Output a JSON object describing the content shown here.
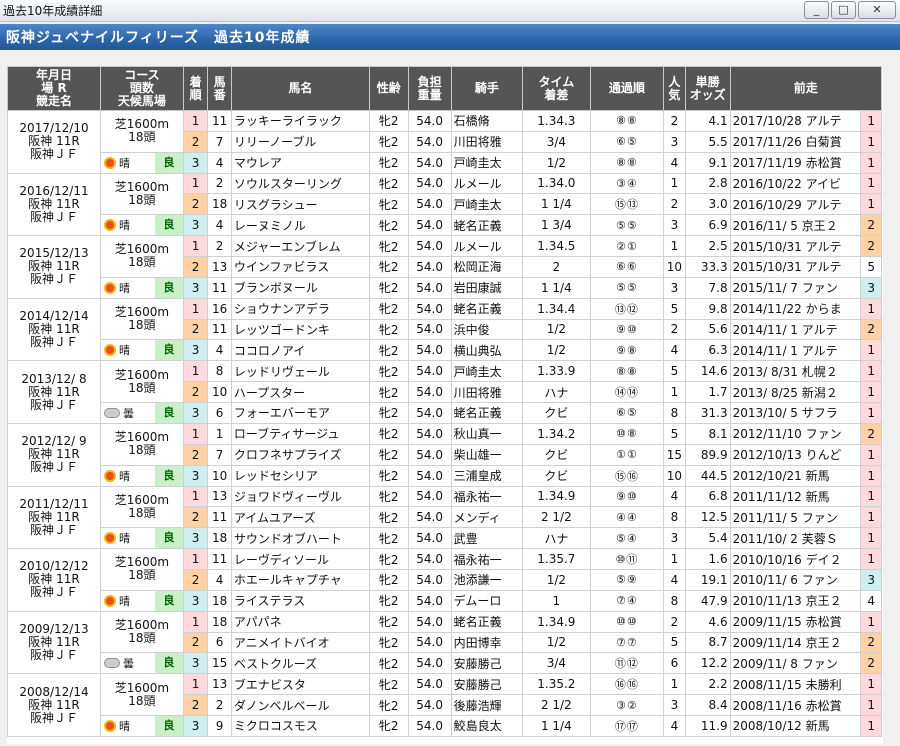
{
  "window": {
    "title": "過去10年成績詳細",
    "btn_min": "_",
    "btn_max": "□",
    "btn_close": "✕"
  },
  "banner": {
    "title": "阪神ジュベナイルフィリーズ　過去10年成績"
  },
  "columns": {
    "date": "年月日\n場 R\n競走名",
    "course": "コース\n頭数\n天候馬場",
    "rank": "着\n順",
    "num": "馬\n番",
    "name": "馬名",
    "sexage": "性齢",
    "weight": "負担\n重量",
    "jockey": "騎手",
    "time": "タイム\n着差",
    "pass": "通過順",
    "pop": "人\n気",
    "odds": "単勝\nオッズ",
    "prev": "前走"
  },
  "races": [
    {
      "date": "2017/12/10\n阪神 11R\n阪神ＪＦ",
      "course": "芝1600m\n18頭",
      "weather": "晴",
      "weather_icon": "sun-icon",
      "ground": "良",
      "rows": [
        {
          "rank": "1",
          "num": "11",
          "name": "ラッキーライラック",
          "sa": "牝2",
          "w": "54.0",
          "j": "石橋脩",
          "t": "1.34.3",
          "p": "⑧⑧",
          "pop": "2",
          "odds": "4.1",
          "prev": "2017/10/28 アルテ",
          "prank": "1"
        },
        {
          "rank": "2",
          "num": "7",
          "name": "リリーノーブル",
          "sa": "牝2",
          "w": "54.0",
          "j": "川田将雅",
          "t": "3/4",
          "p": "⑥⑤",
          "pop": "3",
          "odds": "5.5",
          "prev": "2017/11/26 白菊賞",
          "prank": "1"
        },
        {
          "rank": "3",
          "num": "4",
          "name": "マウレア",
          "sa": "牝2",
          "w": "54.0",
          "j": "戸崎圭太",
          "t": "1/2",
          "p": "⑧⑧",
          "pop": "4",
          "odds": "9.1",
          "prev": "2017/11/19 赤松賞",
          "prank": "1"
        }
      ]
    },
    {
      "date": "2016/12/11\n阪神 11R\n阪神ＪＦ",
      "course": "芝1600m\n18頭",
      "weather": "晴",
      "weather_icon": "sun-icon",
      "ground": "良",
      "rows": [
        {
          "rank": "1",
          "num": "2",
          "name": "ソウルスターリング",
          "sa": "牝2",
          "w": "54.0",
          "j": "ルメール",
          "t": "1.34.0",
          "p": "③④",
          "pop": "1",
          "odds": "2.8",
          "prev": "2016/10/22 アイビ",
          "prank": "1"
        },
        {
          "rank": "2",
          "num": "18",
          "name": "リスグラシュー",
          "sa": "牝2",
          "w": "54.0",
          "j": "戸崎圭太",
          "t": "1 1/4",
          "p": "⑮⑬",
          "pop": "2",
          "odds": "3.0",
          "prev": "2016/10/29 アルテ",
          "prank": "1"
        },
        {
          "rank": "3",
          "num": "4",
          "name": "レーヌミノル",
          "sa": "牝2",
          "w": "54.0",
          "j": "蛯名正義",
          "t": "1 3/4",
          "p": "⑤⑤",
          "pop": "3",
          "odds": "6.9",
          "prev": "2016/11/ 5 京王２",
          "prank": "2"
        }
      ]
    },
    {
      "date": "2015/12/13\n阪神 11R\n阪神ＪＦ",
      "course": "芝1600m\n18頭",
      "weather": "晴",
      "weather_icon": "sun-icon",
      "ground": "良",
      "rows": [
        {
          "rank": "1",
          "num": "2",
          "name": "メジャーエンブレム",
          "sa": "牝2",
          "w": "54.0",
          "j": "ルメール",
          "t": "1.34.5",
          "p": "②①",
          "pop": "1",
          "odds": "2.5",
          "prev": "2015/10/31 アルテ",
          "prank": "2"
        },
        {
          "rank": "2",
          "num": "13",
          "name": "ウインファビラス",
          "sa": "牝2",
          "w": "54.0",
          "j": "松岡正海",
          "t": "2",
          "p": "⑥⑥",
          "pop": "10",
          "odds": "33.3",
          "prev": "2015/10/31 アルテ",
          "prank": "5"
        },
        {
          "rank": "3",
          "num": "11",
          "name": "ブランボヌール",
          "sa": "牝2",
          "w": "54.0",
          "j": "岩田康誠",
          "t": "1 1/4",
          "p": "⑤⑤",
          "pop": "3",
          "odds": "7.8",
          "prev": "2015/11/ 7 ファン",
          "prank": "3"
        }
      ]
    },
    {
      "date": "2014/12/14\n阪神 11R\n阪神ＪＦ",
      "course": "芝1600m\n18頭",
      "weather": "晴",
      "weather_icon": "sun-icon",
      "ground": "良",
      "rows": [
        {
          "rank": "1",
          "num": "16",
          "name": "ショウナンアデラ",
          "sa": "牝2",
          "w": "54.0",
          "j": "蛯名正義",
          "t": "1.34.4",
          "p": "⑬⑫",
          "pop": "5",
          "odds": "9.8",
          "prev": "2014/11/22 からま",
          "prank": "1"
        },
        {
          "rank": "2",
          "num": "11",
          "name": "レッツゴードンキ",
          "sa": "牝2",
          "w": "54.0",
          "j": "浜中俊",
          "t": "1/2",
          "p": "⑨⑩",
          "pop": "2",
          "odds": "5.6",
          "prev": "2014/11/ 1 アルテ",
          "prank": "2"
        },
        {
          "rank": "3",
          "num": "4",
          "name": "ココロノアイ",
          "sa": "牝2",
          "w": "54.0",
          "j": "横山典弘",
          "t": "1/2",
          "p": "⑨⑧",
          "pop": "4",
          "odds": "6.3",
          "prev": "2014/11/ 1 アルテ",
          "prank": "1"
        }
      ]
    },
    {
      "date": "2013/12/ 8\n阪神 11R\n阪神ＪＦ",
      "course": "芝1600m\n18頭",
      "weather": "曇",
      "weather_icon": "cloud-icon",
      "ground": "良",
      "rows": [
        {
          "rank": "1",
          "num": "8",
          "name": "レッドリヴェール",
          "sa": "牝2",
          "w": "54.0",
          "j": "戸崎圭太",
          "t": "1.33.9",
          "p": "⑧⑧",
          "pop": "5",
          "odds": "14.6",
          "prev": "2013/ 8/31 札幌２",
          "prank": "1"
        },
        {
          "rank": "2",
          "num": "10",
          "name": "ハープスター",
          "sa": "牝2",
          "w": "54.0",
          "j": "川田将雅",
          "t": "ハナ",
          "p": "⑭⑭",
          "pop": "1",
          "odds": "1.7",
          "prev": "2013/ 8/25 新潟２",
          "prank": "1"
        },
        {
          "rank": "3",
          "num": "6",
          "name": "フォーエバーモア",
          "sa": "牝2",
          "w": "54.0",
          "j": "蛯名正義",
          "t": "クビ",
          "p": "⑥⑤",
          "pop": "8",
          "odds": "31.3",
          "prev": "2013/10/ 5 サフラ",
          "prank": "1"
        }
      ]
    },
    {
      "date": "2012/12/ 9\n阪神 11R\n阪神ＪＦ",
      "course": "芝1600m\n18頭",
      "weather": "晴",
      "weather_icon": "sun-icon",
      "ground": "良",
      "rows": [
        {
          "rank": "1",
          "num": "1",
          "name": "ローブティサージュ",
          "sa": "牝2",
          "w": "54.0",
          "j": "秋山真一",
          "t": "1.34.2",
          "p": "⑩⑧",
          "pop": "5",
          "odds": "8.1",
          "prev": "2012/11/10 ファン",
          "prank": "2"
        },
        {
          "rank": "2",
          "num": "7",
          "name": "クロフネサプライズ",
          "sa": "牝2",
          "w": "54.0",
          "j": "柴山雄一",
          "t": "クビ",
          "p": "①①",
          "pop": "15",
          "odds": "89.9",
          "prev": "2012/10/13 りんど",
          "prank": "1"
        },
        {
          "rank": "3",
          "num": "10",
          "name": "レッドセシリア",
          "sa": "牝2",
          "w": "54.0",
          "j": "三浦皇成",
          "t": "クビ",
          "p": "⑮⑯",
          "pop": "10",
          "odds": "44.5",
          "prev": "2012/10/21 新馬",
          "prank": "1"
        }
      ]
    },
    {
      "date": "2011/12/11\n阪神 11R\n阪神ＪＦ",
      "course": "芝1600m\n18頭",
      "weather": "晴",
      "weather_icon": "sun-icon",
      "ground": "良",
      "rows": [
        {
          "rank": "1",
          "num": "13",
          "name": "ジョワドヴィーヴル",
          "sa": "牝2",
          "w": "54.0",
          "j": "福永祐一",
          "t": "1.34.9",
          "p": "⑨⑩",
          "pop": "4",
          "odds": "6.8",
          "prev": "2011/11/12 新馬",
          "prank": "1"
        },
        {
          "rank": "2",
          "num": "11",
          "name": "アイムユアーズ",
          "sa": "牝2",
          "w": "54.0",
          "j": "メンディ",
          "t": "2 1/2",
          "p": "④④",
          "pop": "8",
          "odds": "12.5",
          "prev": "2011/11/ 5 ファン",
          "prank": "1"
        },
        {
          "rank": "3",
          "num": "18",
          "name": "サウンドオブハート",
          "sa": "牝2",
          "w": "54.0",
          "j": "武豊",
          "t": "ハナ",
          "p": "⑤④",
          "pop": "3",
          "odds": "5.4",
          "prev": "2011/10/ 2 芙蓉Ｓ",
          "prank": "1"
        }
      ]
    },
    {
      "date": "2010/12/12\n阪神 11R\n阪神ＪＦ",
      "course": "芝1600m\n18頭",
      "weather": "晴",
      "weather_icon": "sun-icon",
      "ground": "良",
      "rows": [
        {
          "rank": "1",
          "num": "11",
          "name": "レーヴディソール",
          "sa": "牝2",
          "w": "54.0",
          "j": "福永祐一",
          "t": "1.35.7",
          "p": "⑩⑪",
          "pop": "1",
          "odds": "1.6",
          "prev": "2010/10/16 デイ２",
          "prank": "1"
        },
        {
          "rank": "2",
          "num": "4",
          "name": "ホエールキャプチャ",
          "sa": "牝2",
          "w": "54.0",
          "j": "池添謙一",
          "t": "1/2",
          "p": "⑤⑨",
          "pop": "4",
          "odds": "19.1",
          "prev": "2010/11/ 6 ファン",
          "prank": "3"
        },
        {
          "rank": "3",
          "num": "18",
          "name": "ライステラス",
          "sa": "牝2",
          "w": "54.0",
          "j": "デムーロ",
          "t": "1",
          "p": "⑦④",
          "pop": "8",
          "odds": "47.9",
          "prev": "2010/11/13 京王２",
          "prank": "4"
        }
      ]
    },
    {
      "date": "2009/12/13\n阪神 11R\n阪神ＪＦ",
      "course": "芝1600m\n18頭",
      "weather": "曇",
      "weather_icon": "cloud-icon",
      "ground": "良",
      "rows": [
        {
          "rank": "1",
          "num": "18",
          "name": "アパパネ",
          "sa": "牝2",
          "w": "54.0",
          "j": "蛯名正義",
          "t": "1.34.9",
          "p": "⑩⑩",
          "pop": "2",
          "odds": "4.6",
          "prev": "2009/11/15 赤松賞",
          "prank": "1"
        },
        {
          "rank": "2",
          "num": "6",
          "name": "アニメイトバイオ",
          "sa": "牝2",
          "w": "54.0",
          "j": "内田博幸",
          "t": "1/2",
          "p": "⑦⑦",
          "pop": "5",
          "odds": "8.7",
          "prev": "2009/11/14 京王２",
          "prank": "2"
        },
        {
          "rank": "3",
          "num": "15",
          "name": "ベストクルーズ",
          "sa": "牝2",
          "w": "54.0",
          "j": "安藤勝己",
          "t": "3/4",
          "p": "⑪⑫",
          "pop": "6",
          "odds": "12.2",
          "prev": "2009/11/ 8 ファン",
          "prank": "2"
        }
      ]
    },
    {
      "date": "2008/12/14\n阪神 11R\n阪神ＪＦ",
      "course": "芝1600m\n18頭",
      "weather": "晴",
      "weather_icon": "sun-icon",
      "ground": "良",
      "rows": [
        {
          "rank": "1",
          "num": "13",
          "name": "ブエナビスタ",
          "sa": "牝2",
          "w": "54.0",
          "j": "安藤勝己",
          "t": "1.35.2",
          "p": "⑯⑯",
          "pop": "1",
          "odds": "2.2",
          "prev": "2008/11/15 未勝利",
          "prank": "1"
        },
        {
          "rank": "2",
          "num": "2",
          "name": "ダノンベルベール",
          "sa": "牝2",
          "w": "54.0",
          "j": "後藤浩輝",
          "t": "2 1/2",
          "p": "③②",
          "pop": "3",
          "odds": "8.4",
          "prev": "2008/11/16 赤松賞",
          "prank": "1"
        },
        {
          "rank": "3",
          "num": "9",
          "name": "ミクロコスモス",
          "sa": "牝2",
          "w": "54.0",
          "j": "鮫島良太",
          "t": "1 1/4",
          "p": "⑰⑰",
          "pop": "4",
          "odds": "11.9",
          "prev": "2008/10/12 新馬",
          "prank": "1"
        }
      ]
    }
  ]
}
